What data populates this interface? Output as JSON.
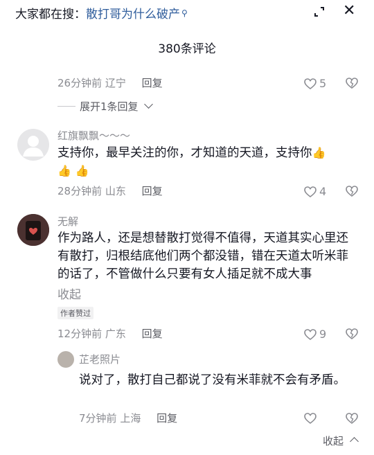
{
  "header": {
    "search_prefix": "大家都在搜：",
    "search_query": "散打哥为什么破产",
    "comment_count": "380条评论"
  },
  "comments": [
    {
      "time": "26分钟前",
      "location": "辽宁",
      "reply_label": "回复",
      "likes": "5",
      "expand_replies": "展开1条回复"
    },
    {
      "nickname": "红旗飘飘～～～",
      "text": "支持你，最早关注的你，才知道的天道，支持你",
      "time": "28分钟前",
      "location": "山东",
      "reply_label": "回复",
      "likes": "4"
    },
    {
      "nickname": "无解",
      "text": "作为路人，还是想替散打觉得不值得，天道其实心里还有散打，归根结底他们两个都没错，错在天道太听米菲的话了，不管做什么只要有女人插足就不成大事",
      "fold_label": "收起",
      "author_badge": "作者赞过",
      "time": "12分钟前",
      "location": "广东",
      "reply_label": "回复",
      "likes": "9",
      "reply": {
        "nickname": "芷老照片",
        "text": "说对了，散打自己都说了没有米菲就不会有矛盾。",
        "time": "7分钟前",
        "location": "上海",
        "reply_label": "回复"
      }
    }
  ],
  "footer": {
    "collapse_label": "收起"
  },
  "icons": {
    "search": "search-icon",
    "expand": "expand-icon",
    "close": "close-icon",
    "like": "heart-icon",
    "dislike": "broken-heart-icon",
    "thumbs_up": "thumbs-up-emoji",
    "chevron": "chevron-down-icon"
  },
  "colors": {
    "link": "#2f5d9c",
    "muted": "#8a8b91",
    "text": "#161823"
  }
}
